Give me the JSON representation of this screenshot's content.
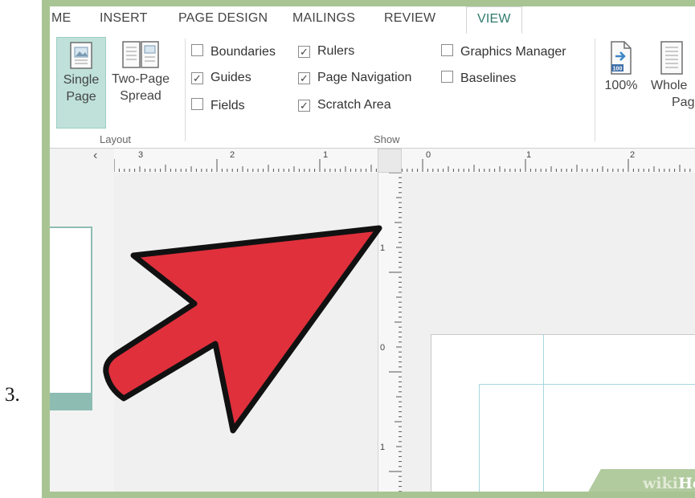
{
  "step": {
    "number": "3."
  },
  "tabs": [
    "ME",
    "INSERT",
    "PAGE DESIGN",
    "MAILINGS",
    "REVIEW",
    "VIEW"
  ],
  "active_tab": "VIEW",
  "ribbon": {
    "layout_group": {
      "label": "Layout",
      "single_page": {
        "line1": "Single",
        "line2": "Page",
        "selected": true
      },
      "two_page": {
        "line1": "Two-Page",
        "line2": "Spread"
      }
    },
    "show_group": {
      "label": "Show",
      "checkboxes": [
        {
          "label": "Boundaries",
          "checked": false
        },
        {
          "label": "Guides",
          "checked": true
        },
        {
          "label": "Fields",
          "checked": false
        },
        {
          "label": "Rulers",
          "checked": true
        },
        {
          "label": "Page Navigation",
          "checked": true
        },
        {
          "label": "Scratch Area",
          "checked": true
        },
        {
          "label": "Graphics Manager",
          "checked": false
        },
        {
          "label": "Baselines",
          "checked": false
        }
      ]
    },
    "zoom_group": {
      "hundred": {
        "label": "100%",
        "icon_text": "100"
      },
      "whole_page": {
        "line1": "Whole",
        "line2": "Page"
      }
    }
  },
  "rulers": {
    "horizontal_numbers": [
      "3",
      "2",
      "1",
      "0",
      "1",
      "2"
    ],
    "vertical_numbers": [
      "1",
      "0",
      "1"
    ],
    "collapse_glyph": "‹"
  },
  "watermark": {
    "part1": "wiki",
    "part2": "How"
  },
  "colors": {
    "frame": "#a9c493",
    "accent": "#2f7a6d",
    "selected_bg": "#bfe1da",
    "arrow": "#e0303c",
    "guide": "#a6d7df"
  }
}
